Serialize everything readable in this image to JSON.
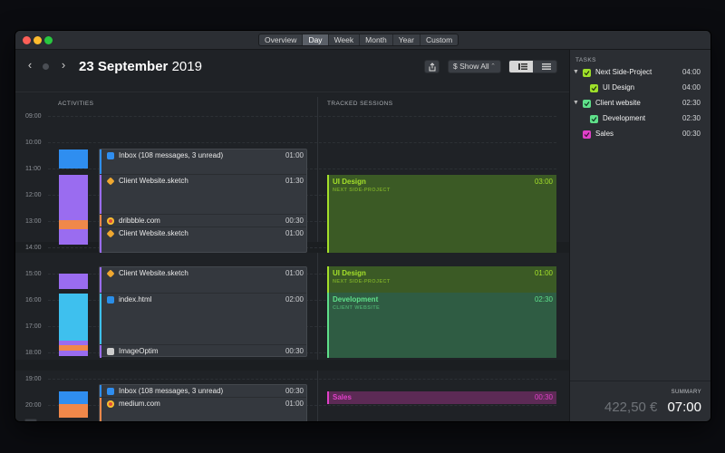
{
  "window": {
    "view_tabs": [
      {
        "label": "Overview",
        "active": false
      },
      {
        "label": "Day",
        "active": true
      },
      {
        "label": "Week",
        "active": false
      },
      {
        "label": "Month",
        "active": false
      },
      {
        "label": "Year",
        "active": false
      },
      {
        "label": "Custom",
        "active": false
      }
    ]
  },
  "toolbar": {
    "prev_label": "‹",
    "next_label": "›",
    "date_main": "23 September",
    "date_year": "2019",
    "filter_label": "$ Show All",
    "filter_caret": "⌃"
  },
  "columns": {
    "activities": "ACTIVITIES",
    "tracked": "TRACKED SESSIONS"
  },
  "hours": [
    "09:00",
    "10:00",
    "11:00",
    "12:00",
    "13:00",
    "14:00",
    "15:00",
    "16:00",
    "17:00",
    "18:00",
    "19:00",
    "20:00"
  ],
  "activity_groups": [
    {
      "items": [
        {
          "name": "Inbox (108 messages, 3 unread)",
          "duration": "01:00",
          "icon": "mail-icon",
          "color": "#2f8ef0"
        },
        {
          "name": "Client Website.sketch",
          "duration": "01:30",
          "icon": "sketch-icon",
          "color": "#f0a830"
        },
        {
          "name": "dribbble.com",
          "duration": "00:30",
          "icon": "chrome-icon",
          "color": "#f0884a"
        },
        {
          "name": "Client Website.sketch",
          "duration": "01:00",
          "icon": "sketch-icon",
          "color": "#f0a830"
        }
      ]
    },
    {
      "items": [
        {
          "name": "Client Website.sketch",
          "duration": "01:00",
          "icon": "sketch-icon",
          "color": "#f0a830"
        },
        {
          "name": "index.html",
          "duration": "02:00",
          "icon": "vscode-icon",
          "color": "#2a8ee8"
        },
        {
          "name": "ImageOptim",
          "duration": "00:30",
          "icon": "imageoptim-icon",
          "color": "#cccccc"
        }
      ]
    },
    {
      "items": [
        {
          "name": "Inbox (108 messages, 3 unread)",
          "duration": "00:30",
          "icon": "mail-icon",
          "color": "#2f8ef0"
        },
        {
          "name": "medium.com",
          "duration": "01:00",
          "icon": "chrome-icon",
          "color": "#f0884a"
        }
      ]
    }
  ],
  "sessions": [
    {
      "title": "UI Design",
      "subtitle": "NEXT SIDE-PROJECT",
      "duration": "03:00",
      "color": "#a4e02a"
    },
    {
      "title": "UI Design",
      "subtitle": "NEXT SIDE-PROJECT",
      "duration": "01:00",
      "color": "#a4e02a"
    },
    {
      "title": "Development",
      "subtitle": "CLIENT WEBSITE",
      "duration": "02:30",
      "color": "#5fe08a"
    },
    {
      "title": "Sales",
      "subtitle": "",
      "duration": "00:30",
      "color": "#e040c8"
    }
  ],
  "tasks": {
    "header": "TASKS",
    "items": [
      {
        "name": "Next Side-Project",
        "duration": "04:00",
        "color": "#9ee02a",
        "expanded": true
      },
      {
        "name": "UI Design",
        "duration": "04:00",
        "color": "#9ee02a"
      },
      {
        "name": "Client website",
        "duration": "02:30",
        "color": "#5fe08a",
        "expanded": true
      },
      {
        "name": "Development",
        "duration": "02:30",
        "color": "#5fe08a"
      },
      {
        "name": "Sales",
        "duration": "00:30",
        "color": "#e040c8"
      }
    ]
  },
  "summary": {
    "label": "SUMMARY",
    "amount": "422,50 €",
    "total": "07:00"
  },
  "zoom": {
    "in": "+",
    "out": "−"
  },
  "colors": {
    "purple": "#9a6cf0",
    "orange": "#f0884a",
    "blue": "#2f8ef0",
    "cyan": "#3ec0ee",
    "green_session": "#a4e02a",
    "teal_session": "#5fe08a",
    "magenta_session": "#e040c8"
  }
}
